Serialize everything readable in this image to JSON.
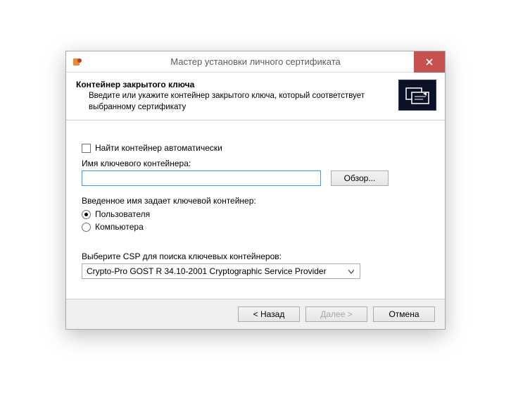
{
  "window": {
    "title": "Мастер установки личного сертификата"
  },
  "header": {
    "title": "Контейнер закрытого ключа",
    "subtitle": "Введите или укажите контейнер закрытого ключа, который соответствует выбранному сертификату"
  },
  "body": {
    "auto_find_label": "Найти контейнер автоматически",
    "auto_find_checked": false,
    "container_name_label": "Имя ключевого контейнера:",
    "container_name_value": "",
    "browse_label": "Обзор...",
    "scope_title": "Введенное имя задает ключевой контейнер:",
    "scope_options": {
      "user": "Пользователя",
      "computer": "Компьютера"
    },
    "scope_selected": "user",
    "csp_title": "Выберите CSP для поиска ключевых контейнеров:",
    "csp_selected": "Crypto-Pro GOST R 34.10-2001 Cryptographic Service Provider"
  },
  "footer": {
    "back": "< Назад",
    "next": "Далее >",
    "cancel": "Отмена",
    "next_enabled": false
  }
}
